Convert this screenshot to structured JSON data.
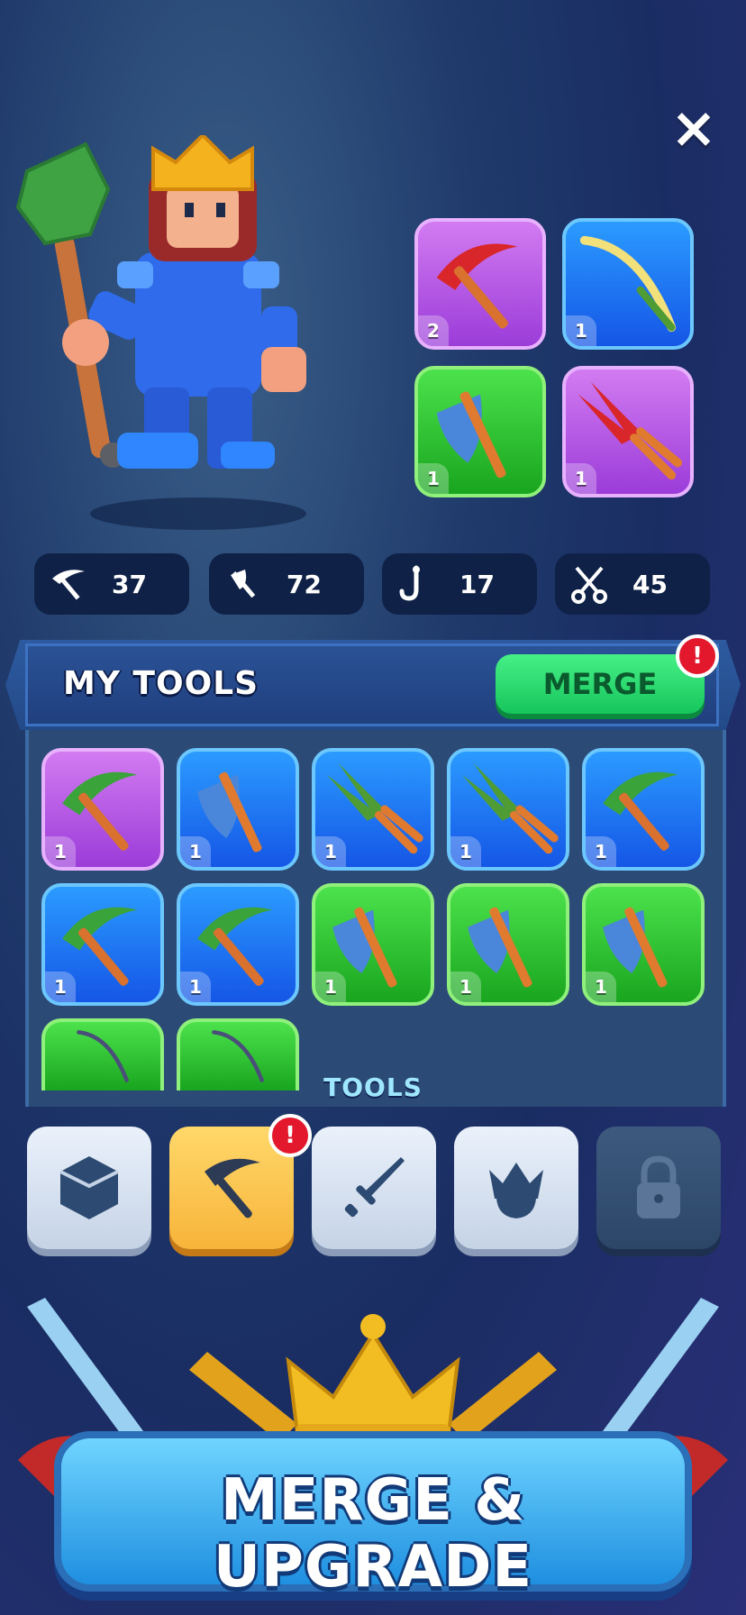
{
  "close_icon": "close-icon",
  "equipped": [
    {
      "tool": "pickaxe-icon",
      "count": "2",
      "rarity": "purple"
    },
    {
      "tool": "fishing-rod-icon",
      "count": "1",
      "rarity": "blue"
    },
    {
      "tool": "axe-icon",
      "count": "1",
      "rarity": "green"
    },
    {
      "tool": "shears-icon",
      "count": "1",
      "rarity": "purple"
    }
  ],
  "stats": [
    {
      "icon": "pickaxe-icon",
      "value": "37"
    },
    {
      "icon": "axe-icon",
      "value": "72"
    },
    {
      "icon": "hook-icon",
      "value": "17"
    },
    {
      "icon": "scissors-icon",
      "value": "45"
    }
  ],
  "panel": {
    "title": "MY TOOLS",
    "merge_label": "MERGE",
    "alert": "!"
  },
  "inventory": [
    {
      "tool": "pickaxe-icon",
      "count": "1",
      "rarity": "purple"
    },
    {
      "tool": "axe-icon",
      "count": "1",
      "rarity": "blue"
    },
    {
      "tool": "shears-icon",
      "count": "1",
      "rarity": "blue"
    },
    {
      "tool": "shears-icon",
      "count": "1",
      "rarity": "blue"
    },
    {
      "tool": "pickaxe-icon",
      "count": "1",
      "rarity": "blue"
    },
    {
      "tool": "pickaxe-icon",
      "count": "1",
      "rarity": "blue"
    },
    {
      "tool": "pickaxe-icon",
      "count": "1",
      "rarity": "blue"
    },
    {
      "tool": "axe-icon",
      "count": "1",
      "rarity": "green"
    },
    {
      "tool": "axe-icon",
      "count": "1",
      "rarity": "green"
    },
    {
      "tool": "axe-icon",
      "count": "1",
      "rarity": "green"
    },
    {
      "tool": "fishing-rod-icon",
      "count": "",
      "rarity": "green"
    },
    {
      "tool": "fishing-rod-icon",
      "count": "",
      "rarity": "green"
    }
  ],
  "categories": {
    "label": "TOOLS",
    "items": [
      {
        "icon": "cube-icon",
        "state": "normal"
      },
      {
        "icon": "pickaxe-icon",
        "state": "active",
        "alert": "!"
      },
      {
        "icon": "sword-icon",
        "state": "normal"
      },
      {
        "icon": "crown-icon",
        "state": "normal"
      },
      {
        "icon": "lock-icon",
        "state": "locked"
      }
    ]
  },
  "promo": {
    "text": "MERGE & UPGRADE"
  },
  "colors": {
    "purple": "#b35ae6",
    "blue": "#1f78f2",
    "green": "#2cc235",
    "merge": "#22d86a",
    "alert": "#e3182d"
  }
}
